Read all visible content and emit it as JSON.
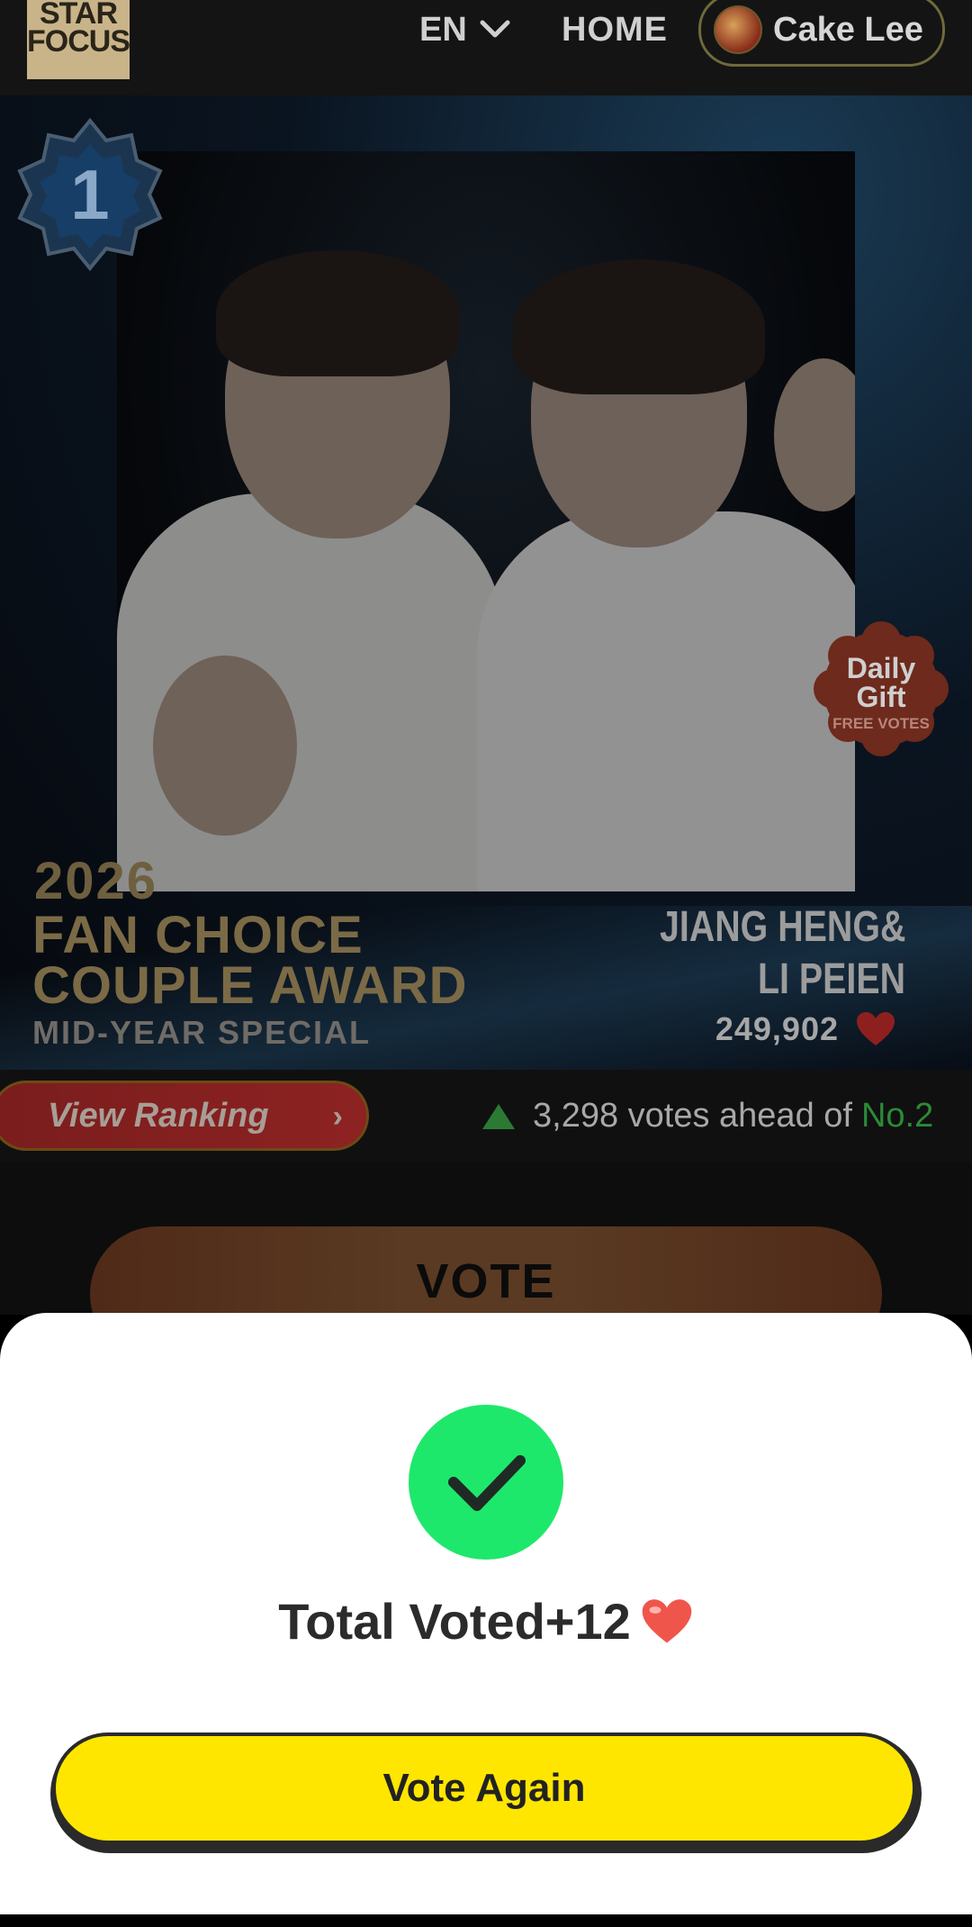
{
  "header": {
    "logo_line1": "STAR",
    "logo_line2": "FOCUS",
    "language": "EN",
    "home_label": "HOME",
    "user_name": "Cake Lee"
  },
  "hero": {
    "rank": "1",
    "gift_line1": "Daily",
    "gift_line2": "Gift",
    "gift_line3": "FREE VOTES",
    "award_year": "2026",
    "award_line1": "FAN CHOICE",
    "award_line2": "COUPLE AWARD",
    "award_sub": "MID-YEAR SPECIAL",
    "couple_line1": "JIANG HENG&",
    "couple_line2": "LI PEIEN",
    "vote_count": "249,902"
  },
  "ranking": {
    "view_label": "View Ranking",
    "ahead_text": "3,298 votes ahead of",
    "ahead_rank": "No.2"
  },
  "vote": {
    "label": "VOTE"
  },
  "sheet": {
    "total_text": "Total Voted+12",
    "button_label": "Vote Again"
  },
  "colors": {
    "accent_yellow": "#ffe600",
    "success_green": "#1ee86b",
    "rank_up_green": "#2b8a38"
  }
}
